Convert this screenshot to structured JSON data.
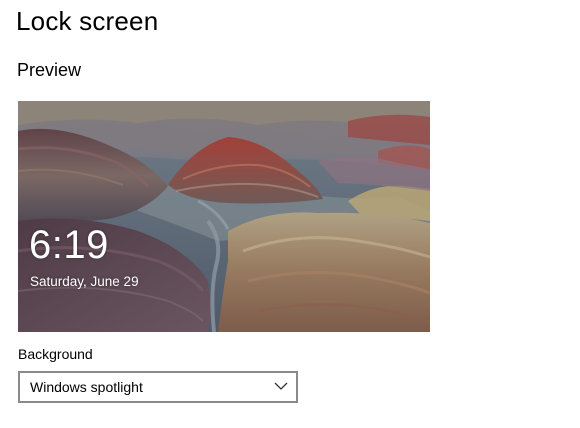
{
  "page": {
    "title": "Lock screen",
    "preview_heading": "Preview"
  },
  "preview": {
    "time": "6:19",
    "date": "Saturday, June 29",
    "image_description_icon": "landscape-painted-hills"
  },
  "background": {
    "label": "Background",
    "selected": "Windows spotlight",
    "dropdown_icon": "chevron-down-icon"
  },
  "colors": {
    "border": "#8a8a8a",
    "text": "#000000",
    "overlay_text": "#ffffff"
  }
}
